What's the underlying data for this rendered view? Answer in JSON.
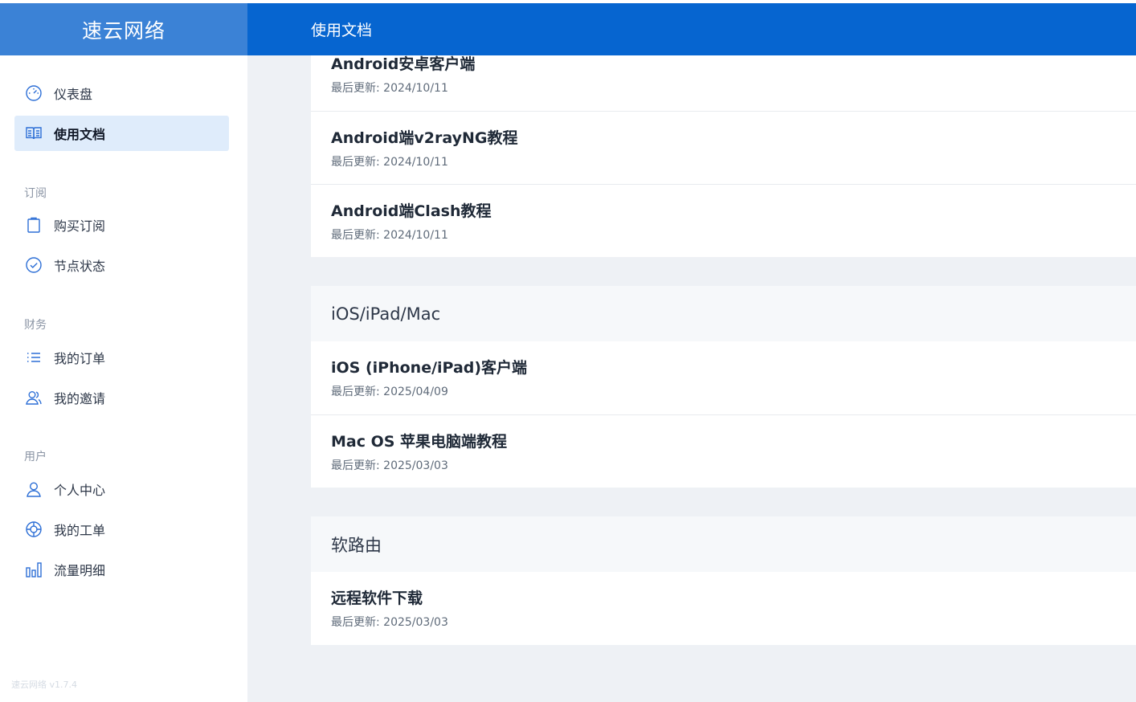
{
  "brand": {
    "name": "速云网络",
    "version": "速云网络 v1.7.4"
  },
  "header": {
    "title": "使用文档"
  },
  "sidebar": {
    "top_items": [
      {
        "label": "仪表盘",
        "icon": "dashboard-icon"
      },
      {
        "label": "使用文档",
        "icon": "book-icon",
        "active": true
      }
    ],
    "groups": [
      {
        "title": "订阅",
        "items": [
          {
            "label": "购买订阅",
            "icon": "clipboard-icon"
          },
          {
            "label": "节点状态",
            "icon": "check-circle-icon"
          }
        ]
      },
      {
        "title": "财务",
        "items": [
          {
            "label": "我的订单",
            "icon": "list-icon"
          },
          {
            "label": "我的邀请",
            "icon": "users-icon"
          }
        ]
      },
      {
        "title": "用户",
        "items": [
          {
            "label": "个人中心",
            "icon": "user-icon"
          },
          {
            "label": "我的工单",
            "icon": "lifebuoy-icon"
          },
          {
            "label": "流量明细",
            "icon": "bar-chart-icon"
          }
        ]
      }
    ]
  },
  "main": {
    "sections": [
      {
        "title": "",
        "docs": [
          {
            "title": "Android安卓客户端",
            "updated": "最后更新: 2024/10/11"
          },
          {
            "title": "Android端v2rayNG教程",
            "updated": "最后更新: 2024/10/11"
          },
          {
            "title": "Android端Clash教程",
            "updated": "最后更新: 2024/10/11"
          }
        ]
      },
      {
        "title": "iOS/iPad/Mac",
        "docs": [
          {
            "title": "iOS (iPhone/iPad)客户端",
            "updated": "最后更新: 2025/04/09"
          },
          {
            "title": "Mac OS 苹果电脑端教程",
            "updated": "最后更新: 2025/03/03"
          }
        ]
      },
      {
        "title": "软路由",
        "docs": [
          {
            "title": "远程软件下载",
            "updated": "最后更新: 2025/03/03"
          }
        ]
      }
    ]
  },
  "colors": {
    "header_bg": "#0665d0",
    "brand_bg": "#3b82d6",
    "active_bg": "#dfecfb",
    "icon": "#2d6fd6"
  }
}
